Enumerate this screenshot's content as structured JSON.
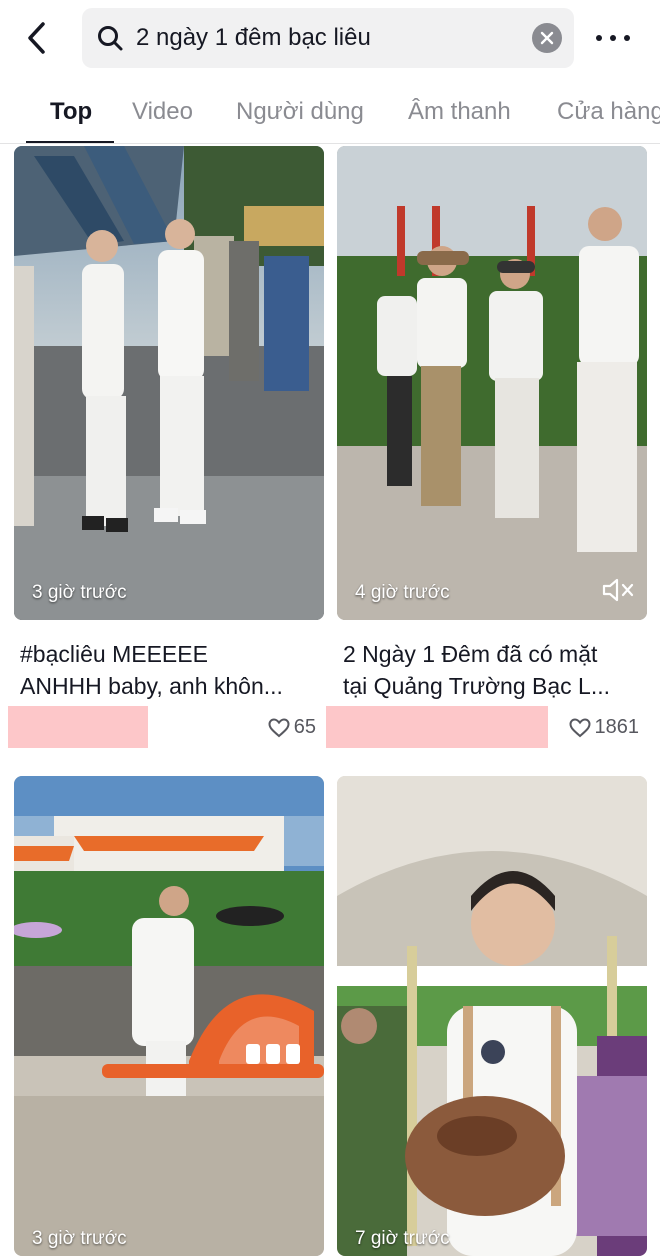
{
  "search": {
    "query": "2 ngày 1 đêm bạc liêu"
  },
  "icons": {
    "back": "chevron-left-icon",
    "search": "search-icon",
    "clear": "clear-icon",
    "more": "more-horizontal-icon",
    "like": "heart-outline-icon",
    "mute": "muted-speaker-icon"
  },
  "tabs": [
    {
      "label": "Top",
      "active": true
    },
    {
      "label": "Video",
      "active": false
    },
    {
      "label": "Người dùng",
      "active": false
    },
    {
      "label": "Âm thanh",
      "active": false
    },
    {
      "label": "Cửa hàng",
      "active": false
    }
  ],
  "results": [
    {
      "timestamp": "3 giờ trước",
      "caption_line1": "#bạcliêu MEEEEE",
      "caption_line2": "ANHHH baby, anh khôn...",
      "likes": "65",
      "muted": false
    },
    {
      "timestamp": "4 giờ trước",
      "caption_line1": "2 Ngày 1 Đêm đã có mặt",
      "caption_line2": "tại Quảng Trường Bạc L...",
      "likes": "1861",
      "muted": true
    },
    {
      "timestamp": "3 giờ trước",
      "muted": false
    },
    {
      "timestamp": "7 giờ trước",
      "muted": false
    }
  ],
  "colors": {
    "text_primary": "#161823",
    "text_secondary": "#8a8b91",
    "search_bg": "#f1f1f2",
    "redaction": "#fdc7c9"
  }
}
